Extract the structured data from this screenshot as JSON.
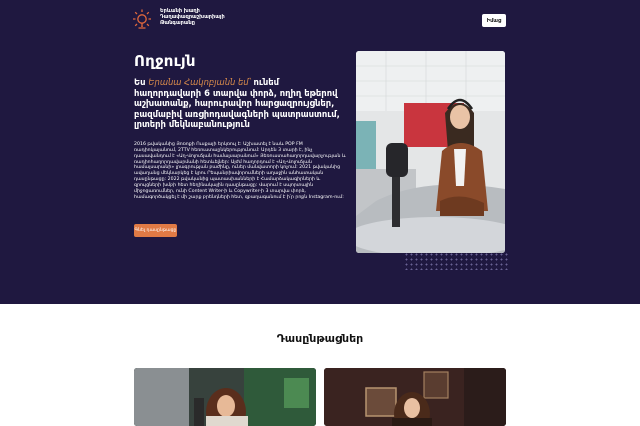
{
  "header": {
    "brand_lines": [
      "Երևանի խաղի",
      "Դաղափազրաշխարիայի",
      "Թանգարանը"
    ],
    "top_button": "Իմաց"
  },
  "hero": {
    "title": "Ողջույն",
    "intro_prefix": "Ես ",
    "intro_name": "Երանա Հակոբյանն եմ՝",
    "intro_rest": "ունեմ հաղորդավարի 6 տարվա փորձ, ողիղ եթերով աշխատանք, հարուրավոր հարցազրույցներ, բազմաբիվ առցիոդավագների պատրաստում, լրտերի մեկնաբանություն",
    "bio": "2016 թվականից Յոռոքի Ուսքայի երկռուլ է: Աշխատել է նաև POP FM ռադիոկայանում, 2TTV հեռուստաընկերությունում: Արդեն 3 տարի է, ինչ դասավանդում է «Աղ-Վոլուճյան համալսարանում» Յեռուստահաղորդավարչության և ռադիոհաղորդավարմանի հետևելներ: Այժմ հաղորդում է «Աղ-Վոլուճյան համալսարանի» լրագրության բաժինը, ուներ մանվատորի կոչում: 2021 թվականից ավաղանց մեկնարկեց է կրու Րեպանրիավորումների աղաջին անհատական դասընթացը: 2022 թվականից պատասխանների է Համարձակագիրների և զրույցների խմբի հետ հեղինակային դասընթացը: Վարում է սպորտային միջոցառումներ, ունի Content Writer-ի և Copywriter-ի 3 տարվա փորձ, համագործակցել է մի շարք բրենդների հետ, զբաղագանում է ի՛ր րոքն Instagram-ում:",
    "cta_label": "Գնել դասընթացը"
  },
  "courses": {
    "title": "Դասընթացներ"
  }
}
